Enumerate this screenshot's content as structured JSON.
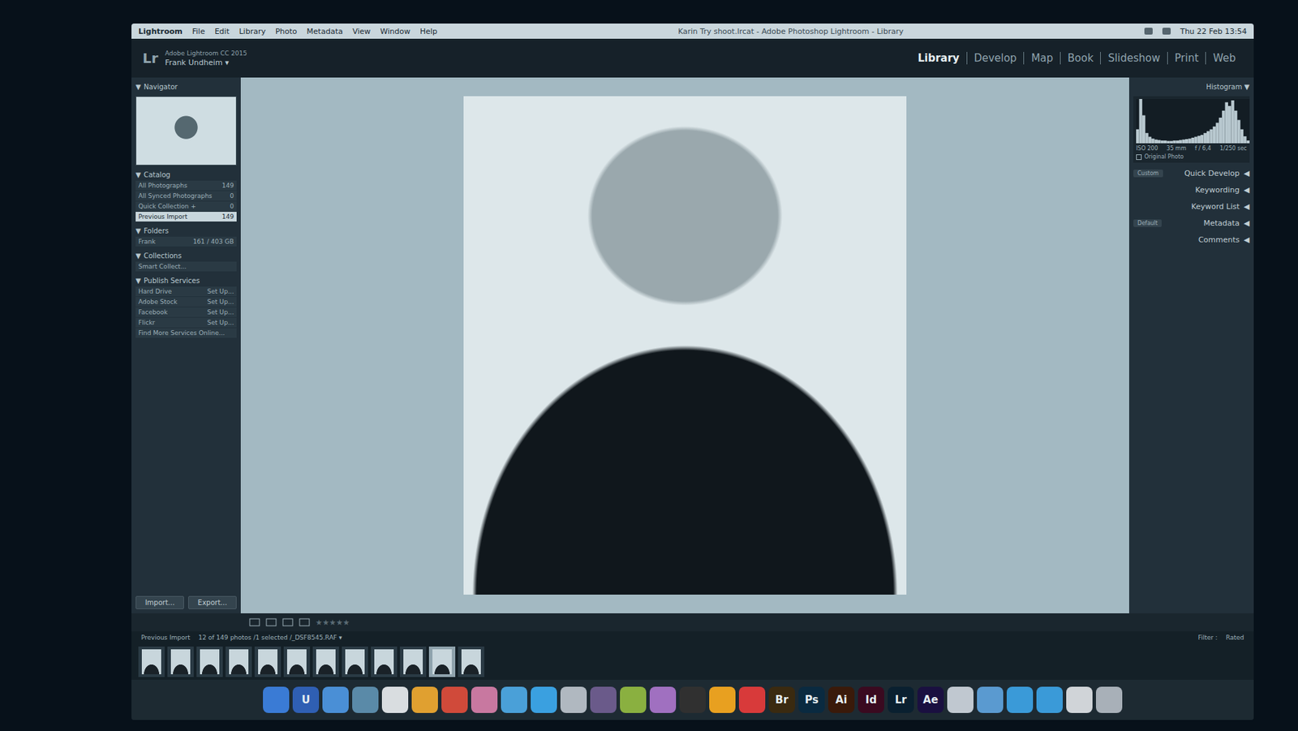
{
  "menubar": {
    "app": "Lightroom",
    "menus": [
      "File",
      "Edit",
      "Library",
      "Photo",
      "Metadata",
      "View",
      "Window",
      "Help"
    ],
    "title": "Karin Try shoot.lrcat - Adobe Photoshop Lightroom - Library",
    "clock": "Thu 22 Feb 13:54"
  },
  "identity": {
    "logo": "Lr",
    "product": "Adobe Lightroom CC 2015",
    "user": "Frank Undheim ▾"
  },
  "modules": [
    {
      "label": "Library",
      "selected": true
    },
    {
      "label": "Develop",
      "selected": false
    },
    {
      "label": "Map",
      "selected": false
    },
    {
      "label": "Book",
      "selected": false
    },
    {
      "label": "Slideshow",
      "selected": false
    },
    {
      "label": "Print",
      "selected": false
    },
    {
      "label": "Web",
      "selected": false
    }
  ],
  "left": {
    "arrow": "▼",
    "navigator": "Navigator",
    "sections": [
      {
        "title": "Catalog",
        "items": [
          {
            "label": "All Photographs",
            "count": "149",
            "selected": false
          },
          {
            "label": "All Synced Photographs",
            "count": "0",
            "selected": false
          },
          {
            "label": "Quick Collection +",
            "count": "0",
            "selected": false
          },
          {
            "label": "Previous Import",
            "count": "149",
            "selected": true
          }
        ]
      },
      {
        "title": "Folders",
        "items": [
          {
            "label": "Frank",
            "count": "161 / 403 GB",
            "selected": false
          }
        ]
      },
      {
        "title": "Collections",
        "items": [
          {
            "label": "Smart Collect...",
            "count": "",
            "selected": false
          }
        ]
      },
      {
        "title": "Publish Services",
        "items": [
          {
            "label": "Hard Drive",
            "count": "Set Up...",
            "selected": false
          },
          {
            "label": "Adobe Stock",
            "count": "Set Up...",
            "selected": false
          },
          {
            "label": "Facebook",
            "count": "Set Up...",
            "selected": false
          },
          {
            "label": "Flickr",
            "count": "Set Up...",
            "selected": false
          },
          {
            "label": "Find More Services Online...",
            "count": "",
            "selected": false
          }
        ]
      }
    ],
    "buttons": [
      "Import...",
      "Export..."
    ]
  },
  "right": {
    "arrow": "◀",
    "histogram": {
      "title": "Histogram ▼",
      "values": [
        30,
        95,
        60,
        22,
        14,
        10,
        8,
        7,
        6,
        6,
        5,
        5,
        6,
        6,
        7,
        8,
        9,
        10,
        12,
        14,
        16,
        18,
        22,
        26,
        30,
        36,
        44,
        55,
        70,
        88,
        80,
        92,
        70,
        50,
        30,
        15,
        6
      ],
      "info": [
        "ISO 200",
        "35 mm",
        "f / 6,4",
        "1/250 sec"
      ],
      "original": "Original Photo"
    },
    "panels": [
      {
        "label": "Quick Develop",
        "preset": "Custom"
      },
      {
        "label": "Keywording",
        "preset": ""
      },
      {
        "label": "Keyword List",
        "preset": ""
      },
      {
        "label": "Metadata",
        "preset": "Default"
      },
      {
        "label": "Comments",
        "preset": ""
      }
    ]
  },
  "toolbar": {
    "star": "★",
    "total": 5,
    "stars": 0
  },
  "filmstrip": {
    "source": "Previous Import",
    "info": "12 of 149 photos /1 selected /_DSF8545.RAF ▾",
    "filter": "Filter :",
    "rated": "Rated",
    "thumbs": [
      {
        "selected": false
      },
      {
        "selected": false
      },
      {
        "selected": false
      },
      {
        "selected": false
      },
      {
        "selected": false
      },
      {
        "selected": false
      },
      {
        "selected": false
      },
      {
        "selected": false
      },
      {
        "selected": false
      },
      {
        "selected": false
      },
      {
        "selected": true
      },
      {
        "selected": false
      }
    ]
  },
  "dock": [
    {
      "label": "",
      "color": "#3a7bd5"
    },
    {
      "label": "U",
      "color": "#2f5fb3"
    },
    {
      "label": "",
      "color": "#4a8fd6"
    },
    {
      "label": "",
      "color": "#5a8aa8"
    },
    {
      "label": "",
      "color": "#d9dde0"
    },
    {
      "label": "",
      "color": "#e0a030"
    },
    {
      "label": "",
      "color": "#d04a3a"
    },
    {
      "label": "",
      "color": "#c878a0"
    },
    {
      "label": "",
      "color": "#4aa0d8"
    },
    {
      "label": "",
      "color": "#3aa0e0"
    },
    {
      "label": "",
      "color": "#b0b8c0"
    },
    {
      "label": "",
      "color": "#6a5a8a"
    },
    {
      "label": "",
      "color": "#8ab040"
    },
    {
      "label": "",
      "color": "#a070c0"
    },
    {
      "label": "",
      "color": "#303030"
    },
    {
      "label": "",
      "color": "#e8a020"
    },
    {
      "label": "",
      "color": "#d83a3a"
    },
    {
      "label": "Br",
      "color": "#3a2a10"
    },
    {
      "label": "Ps",
      "color": "#0a2a40"
    },
    {
      "label": "Ai",
      "color": "#3a1a0a"
    },
    {
      "label": "Id",
      "color": "#3a0a20"
    },
    {
      "label": "Lr",
      "color": "#0a2030"
    },
    {
      "label": "Ae",
      "color": "#1a1040"
    },
    {
      "label": "",
      "color": "#c0c8d0"
    },
    {
      "label": "",
      "color": "#5a9ad0"
    },
    {
      "label": "",
      "color": "#3a9ad8"
    },
    {
      "label": "",
      "color": "#3a9ad8"
    },
    {
      "label": "",
      "color": "#d0d4d8"
    },
    {
      "label": "",
      "color": "#a8b0b8"
    }
  ]
}
